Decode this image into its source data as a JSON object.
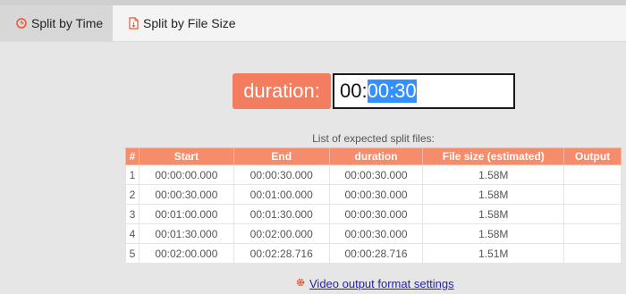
{
  "tabs": [
    {
      "label": "Split by Time",
      "icon": "clock-icon",
      "active": true
    },
    {
      "label": "Split by File Size",
      "icon": "file-icon",
      "active": false
    }
  ],
  "duration": {
    "label": "duration:",
    "value_prefix": "00:",
    "value_selected": "00:30"
  },
  "list": {
    "caption": "List of expected split files:",
    "columns": [
      "#",
      "Start",
      "End",
      "duration",
      "File size (estimated)",
      "Output"
    ],
    "rows": [
      [
        "1",
        "00:00:00.000",
        "00:00:30.000",
        "00:00:30.000",
        "1.58M",
        ""
      ],
      [
        "2",
        "00:00:30.000",
        "00:01:00.000",
        "00:00:30.000",
        "1.58M",
        ""
      ],
      [
        "3",
        "00:01:00.000",
        "00:01:30.000",
        "00:00:30.000",
        "1.58M",
        ""
      ],
      [
        "4",
        "00:01:30.000",
        "00:02:00.000",
        "00:00:30.000",
        "1.58M",
        ""
      ],
      [
        "5",
        "00:02:00.000",
        "00:02:28.716",
        "00:00:28.716",
        "1.51M",
        ""
      ]
    ]
  },
  "footer": {
    "link_label": "Video output format settings",
    "icon": "gear-icon"
  },
  "colors": {
    "accent": "#f47d5f",
    "header": "#f58d6c",
    "selection": "#3390ff",
    "link": "#2222bb"
  }
}
